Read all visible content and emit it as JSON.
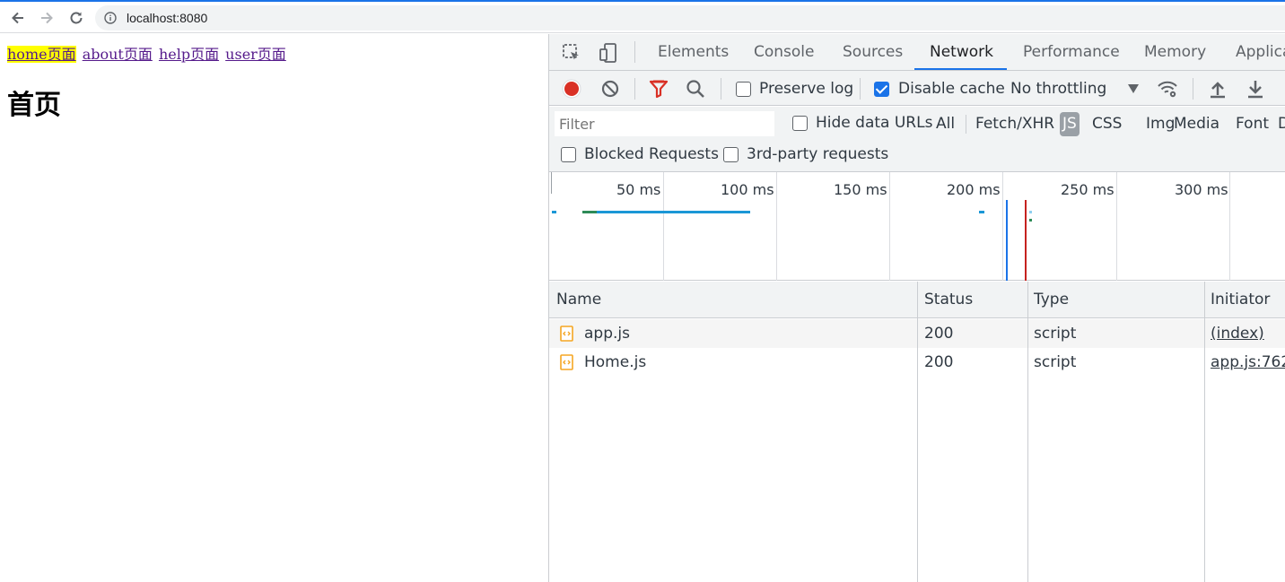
{
  "browser": {
    "url": "localhost:8080",
    "icons": {
      "back": "arrow-left-icon",
      "forward": "arrow-right-icon",
      "reload": "reload-icon",
      "info": "info-icon"
    }
  },
  "page": {
    "links": [
      {
        "label": "home页面",
        "active": true
      },
      {
        "label": "about页面",
        "active": false
      },
      {
        "label": "help页面",
        "active": false
      },
      {
        "label": "user页面",
        "active": false
      }
    ],
    "heading": "首页"
  },
  "devtools": {
    "tabs": [
      "Elements",
      "Console",
      "Sources",
      "Network",
      "Performance",
      "Memory",
      "Applica"
    ],
    "active_tab": "Network",
    "toolbar": {
      "preserve_log": "Preserve log",
      "preserve_log_checked": false,
      "disable_cache": "Disable cache",
      "disable_cache_checked": true,
      "throttling": "No throttling"
    },
    "filter": {
      "placeholder": "Filter",
      "hide_data_urls": "Hide data URLs",
      "types": [
        "All",
        "Fetch/XHR",
        "JS",
        "CSS",
        "Img",
        "Media",
        "Font",
        "D"
      ],
      "active_type": "JS",
      "blocked_requests": "Blocked Requests",
      "third_party": "3rd-party requests"
    },
    "overview": {
      "ticks": [
        "50 ms",
        "100 ms",
        "150 ms",
        "200 ms",
        "250 ms",
        "300 ms"
      ]
    },
    "table": {
      "columns": [
        "Name",
        "Status",
        "Type",
        "Initiator"
      ],
      "rows": [
        {
          "name": "app.js",
          "status": "200",
          "type": "script",
          "initiator": "(index)"
        },
        {
          "name": "Home.js",
          "status": "200",
          "type": "script",
          "initiator": "app.js:762"
        }
      ]
    },
    "colors": {
      "accent": "#1a73e8",
      "record": "#d93025",
      "filter": "#d93025",
      "bar": "#1a97d6",
      "bar_green": "#2e8b57",
      "load_line": "#c5221f",
      "dcl_line": "#1a73e8",
      "js_icon": "#f5a623"
    }
  }
}
